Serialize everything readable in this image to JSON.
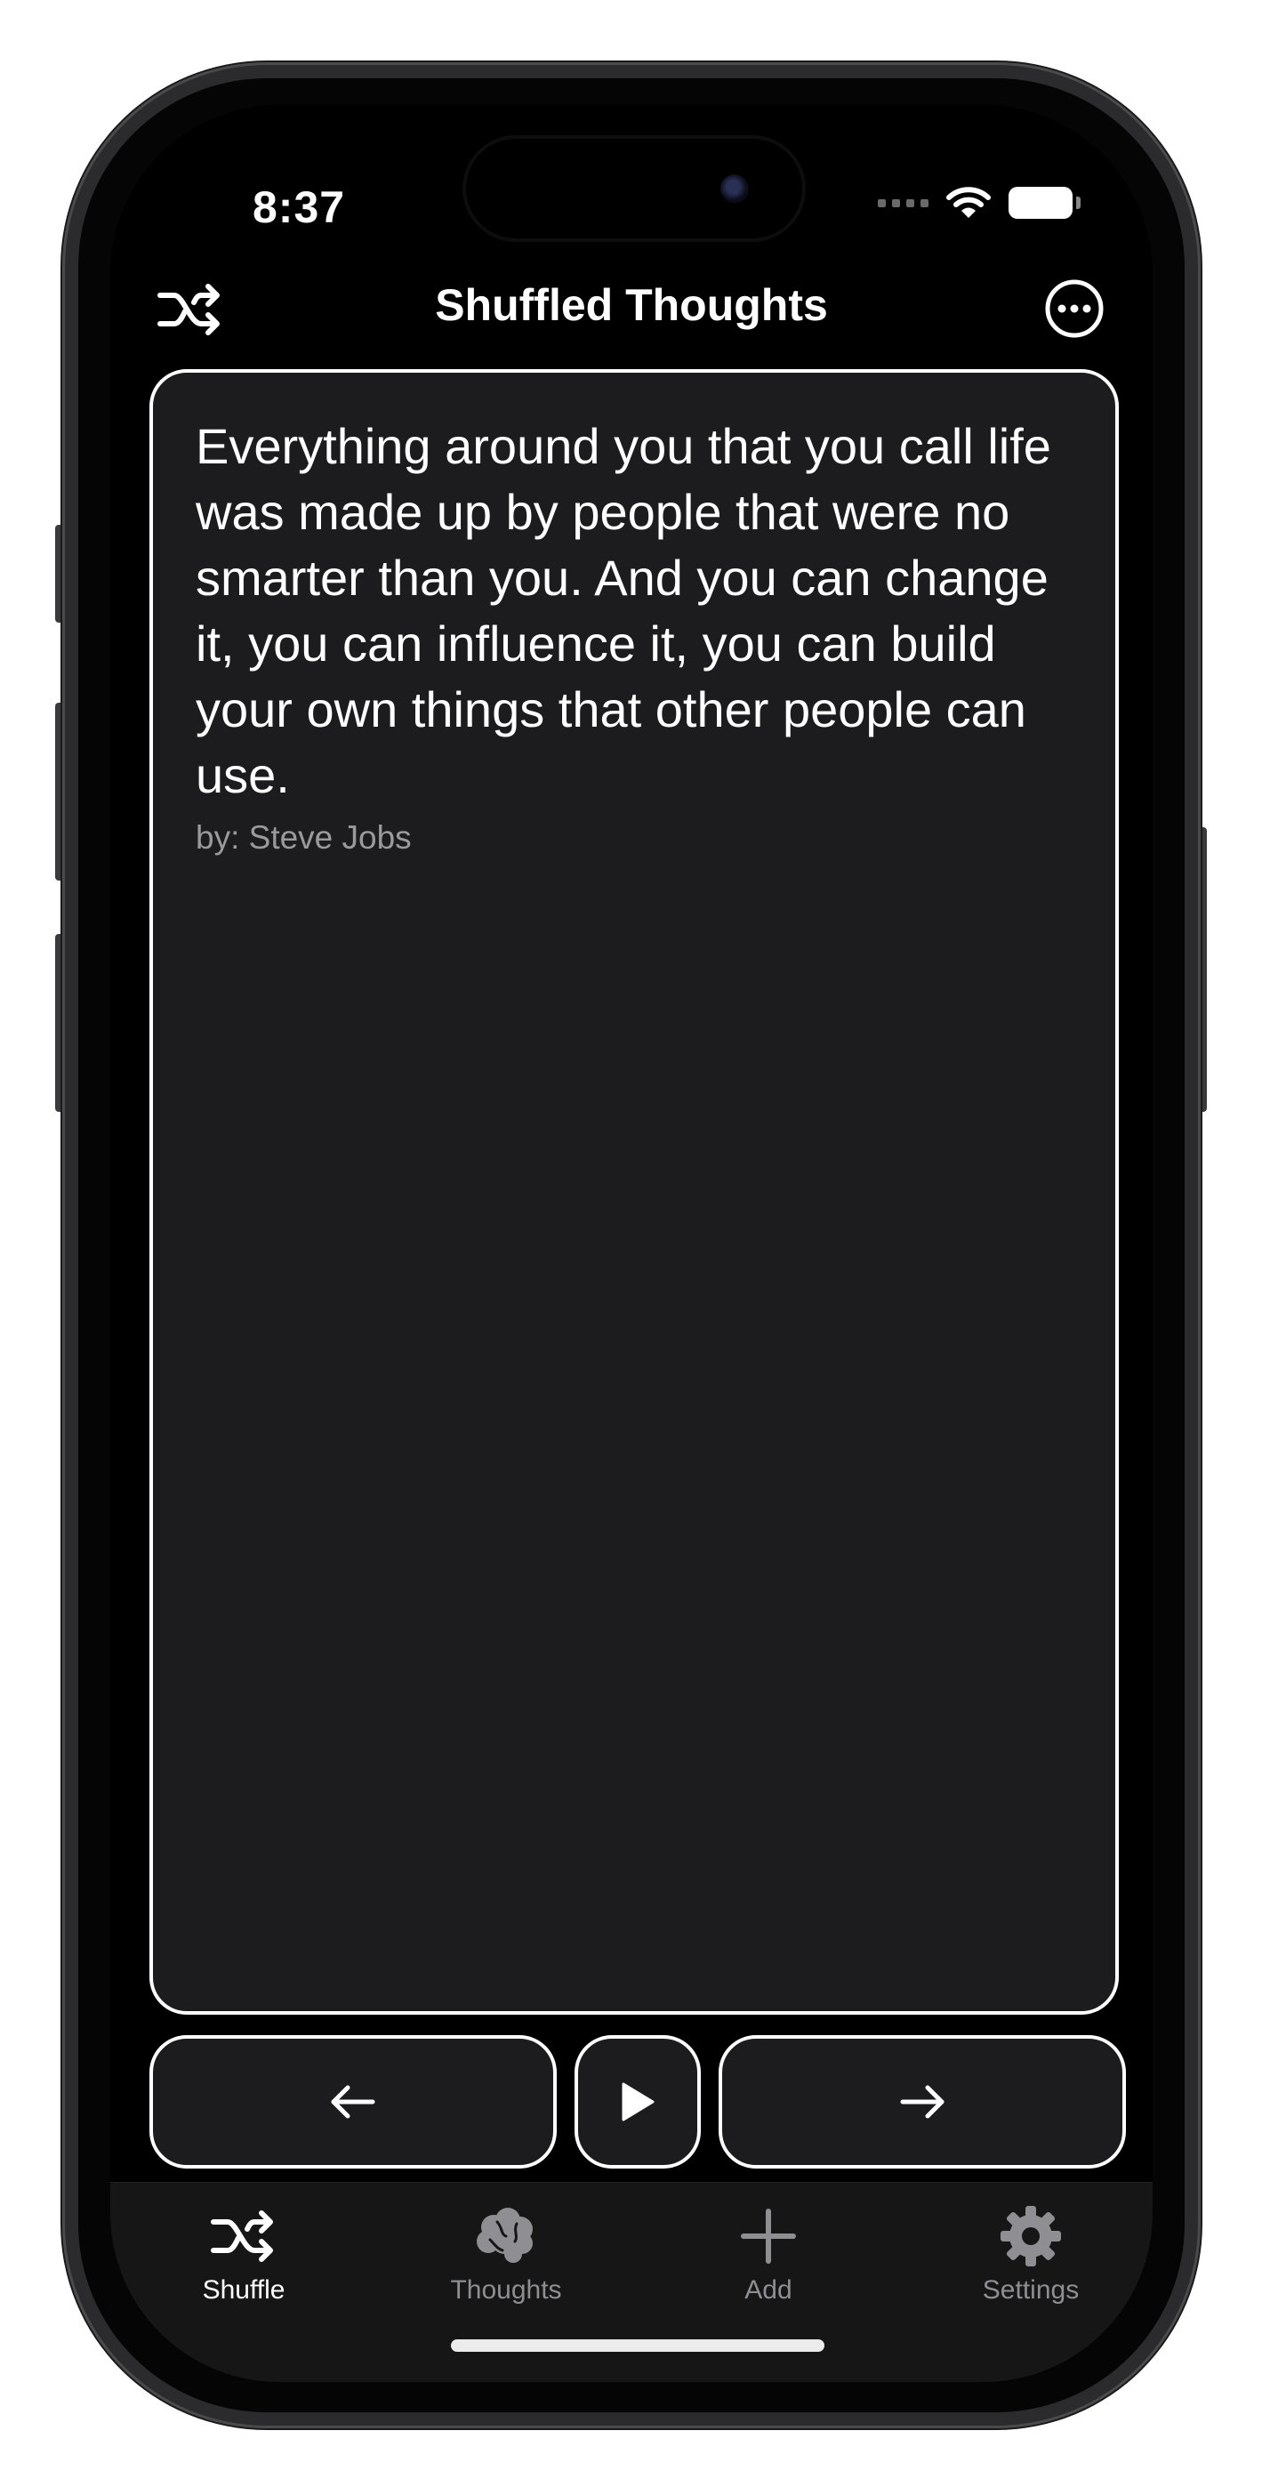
{
  "status_bar": {
    "time": "8:37"
  },
  "nav": {
    "title": "Shuffled Thoughts",
    "left_icon": "shuffle-icon",
    "right_icon": "ellipsis-circle-icon"
  },
  "quote_card": {
    "text": "Everything around you that you call life was made up by people that were no smarter than you. And you can change it, you can influence it, you can build your own things that other people can use.",
    "author": "by: Steve Jobs"
  },
  "controls": {
    "previous_icon": "arrow-left-icon",
    "play_icon": "play-icon",
    "next_icon": "arrow-right-icon"
  },
  "tabs": [
    {
      "label": "Shuffle",
      "icon": "shuffle-icon",
      "selected": true
    },
    {
      "label": "Thoughts",
      "icon": "brain-icon",
      "selected": false
    },
    {
      "label": "Add",
      "icon": "plus-icon",
      "selected": false
    },
    {
      "label": "Settings",
      "icon": "gear-icon",
      "selected": false
    }
  ],
  "colors": {
    "background": "#000000",
    "card": "#1c1c1e",
    "border": "#ffffff",
    "secondary_text": "#9a9a9e",
    "tab_inactive": "#8e8e93"
  }
}
